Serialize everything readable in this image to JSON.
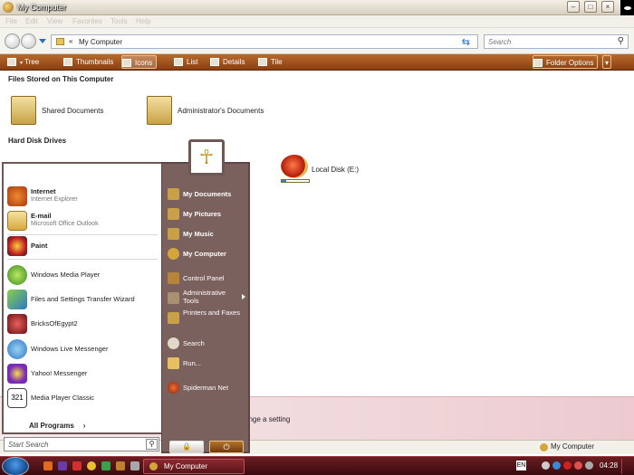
{
  "window": {
    "title": "My Computer"
  },
  "menubar": [
    "File",
    "Edit",
    "View",
    "Favorites",
    "Tools",
    "Help"
  ],
  "address": {
    "chevron": "«",
    "path": "My Computer",
    "search_placeholder": "Search"
  },
  "toolbar": {
    "tree": "Tree",
    "thumbnails": "Thumbnails",
    "icons": "Icons",
    "list": "List",
    "details": "Details",
    "tile": "Tile",
    "folder_options": "Folder Options"
  },
  "content": {
    "files_group": "Files Stored on This Computer",
    "shared_docs": "Shared Documents",
    "admin_docs": "Administrator's Documents",
    "hdd_group": "Hard Disk Drives",
    "local_disk_e": "Local Disk (E:)",
    "local_disk_e_usage_pct": 15,
    "details_text": "ange a setting"
  },
  "statusbar": {
    "location": "My Computer"
  },
  "startmenu": {
    "pinned": [
      {
        "title": "Internet",
        "subtitle": "Internet Explorer"
      },
      {
        "title": "E-mail",
        "subtitle": "Microsoft Office Outlook"
      }
    ],
    "recent": [
      "Paint",
      "Windows Media Player",
      "Files and Settings Transfer Wizard",
      "BricksOfEgypt2",
      "Windows Live Messenger",
      "Yahoo! Messenger",
      "Media Player Classic"
    ],
    "all_programs": "All Programs",
    "search_placeholder": "Start Search",
    "right": {
      "my_documents": "My Documents",
      "my_pictures": "My Pictures",
      "my_music": "My Music",
      "my_computer": "My Computer",
      "control_panel": "Control Panel",
      "admin_tools": "Administrative Tools",
      "printers": "Printers and Faxes",
      "search": "Search",
      "run": "Run...",
      "spiderman": "Spiderman Net"
    }
  },
  "taskbar": {
    "window_button": "My Computer",
    "lang": "EN",
    "clock": "04:28"
  }
}
